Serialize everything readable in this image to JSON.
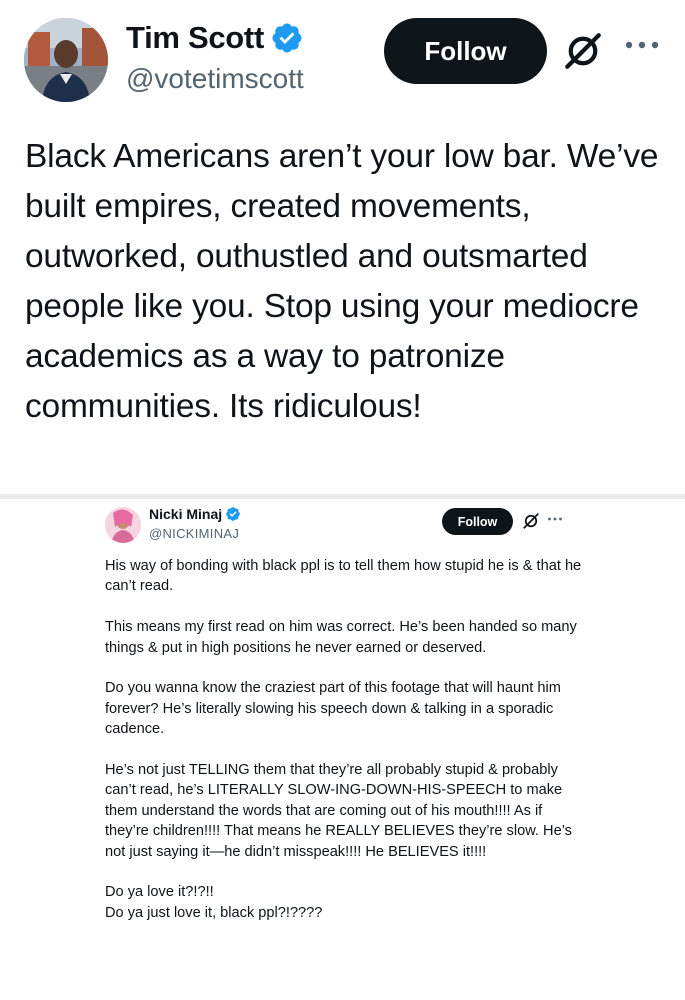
{
  "tweet": {
    "author_name": "Tim Scott",
    "author_handle": "@votetimscott",
    "follow_label": "Follow",
    "verified_icon": "verified-badge-icon",
    "grok_icon": "grok-icon",
    "more_icon": "more-icon",
    "text": "Black Americans aren’t your low bar. We’ve built empires, created movements, outworked, outhustled and outsmarted people like you. Stop using your mediocre academics as a way to patronize communities. Its ridiculous!",
    "accent_color": "#1d9bf0"
  },
  "embedded": {
    "author_name": "Nicki Minaj",
    "author_handle": "@NICKIMINAJ",
    "follow_label": "Follow",
    "paragraphs": [
      "His way of bonding with black ppl is to tell them how stupid he is & that he can’t read.",
      "This means my first read on him was correct. He’s been handed so many things & put in high positions he never earned or deserved.",
      "Do you wanna know the craziest part of this footage that will haunt him forever? He’s literally slowing his speech down & talking in a sporadic cadence.",
      "He’s not just TELLING them that they’re all probably stupid & probably can’t read, he’s LITERALLY SLOW-ING-DOWN-HIS-SPEECH to make them understand the words that are coming out of his mouth!!!! As if they’re children!!!! That means he REALLY BELIEVES they’re slow. He’s not just saying it—he didn’t misspeak!!!! He BELIEVES it!!!!",
      "Do ya love it?!?!!",
      "Do ya just love it, black ppl?!????"
    ]
  }
}
